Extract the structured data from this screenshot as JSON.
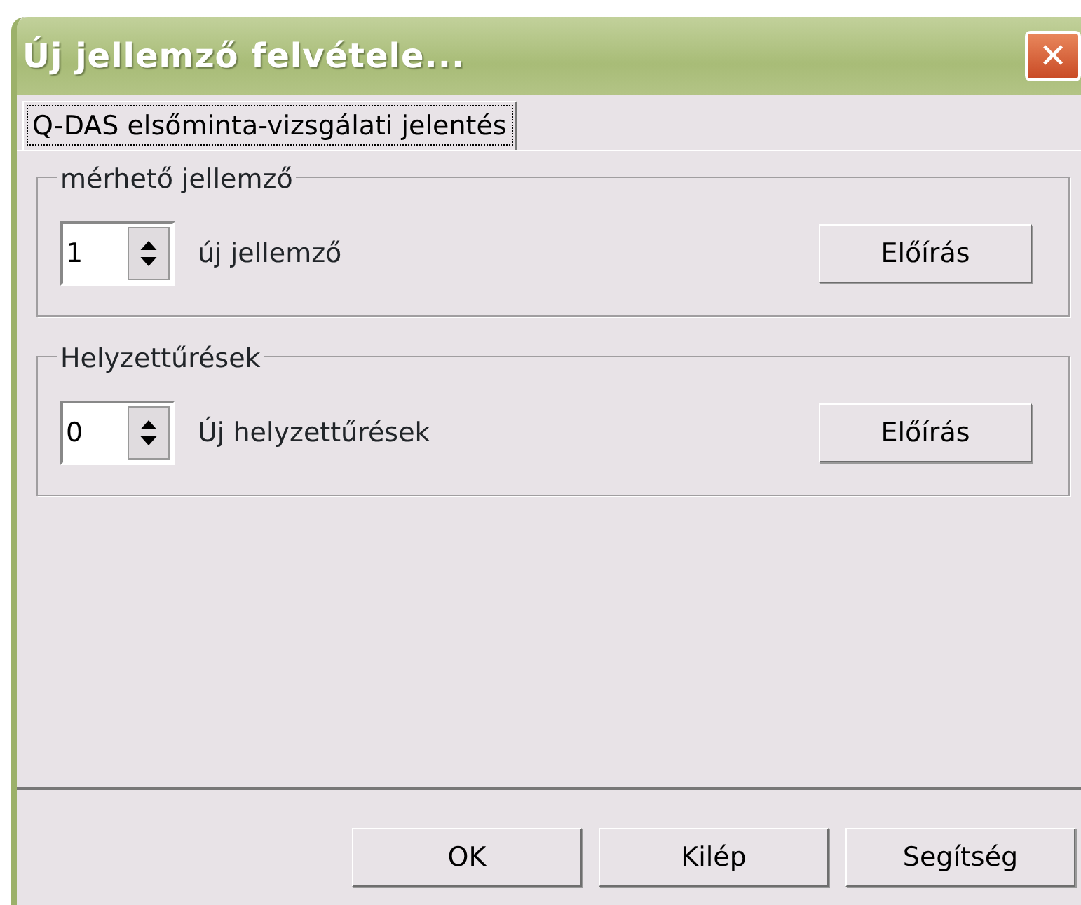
{
  "window": {
    "title": "Új jellemző felvétele...",
    "close": "✕"
  },
  "tabs": [
    {
      "label": "Q-DAS elsőminta-vizsgálati jelentés",
      "selected": true
    }
  ],
  "groups": [
    {
      "title": "mérhető jellemző",
      "spinner_value": "1",
      "label": "új jellemző",
      "button": "Előírás"
    },
    {
      "title": "Helyzettűrések",
      "spinner_value": "0",
      "label": "Új helyzettűrések",
      "button": "Előírás"
    }
  ],
  "buttons": [
    "OK",
    "Kilép",
    "Segítség"
  ]
}
